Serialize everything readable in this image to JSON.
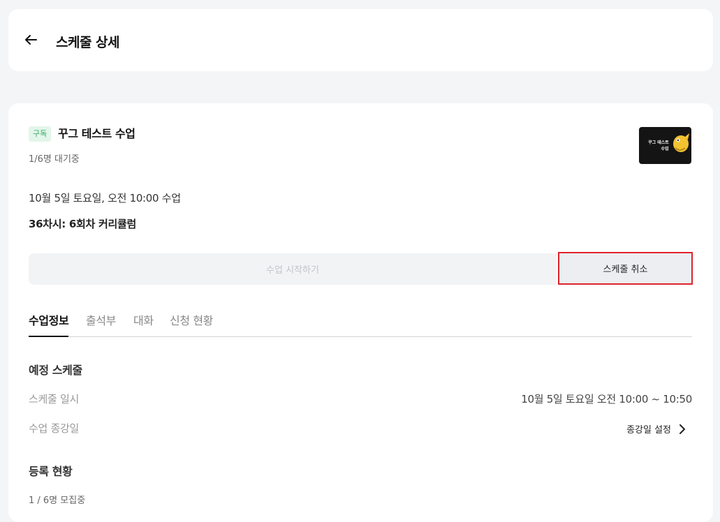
{
  "header": {
    "title": "스케줄 상세",
    "back_icon": "arrow-left-icon"
  },
  "class": {
    "badge": "구독",
    "title": "꾸그 테스트 수업",
    "waiting": "1/6명 대기중",
    "thumbnail_text_line1": "꾸그 테스트",
    "thumbnail_text_line2": "수업",
    "schedule": "10월 5일 토요일, 오전 10:00 수업",
    "curriculum": "36차시: 6회차 커리큘럼"
  },
  "actions": {
    "start_label": "수업 시작하기",
    "cancel_label": "스케줄 취소"
  },
  "tabs": [
    {
      "label": "수업정보",
      "active": true
    },
    {
      "label": "출석부",
      "active": false
    },
    {
      "label": "대화",
      "active": false
    },
    {
      "label": "신청 현황",
      "active": false
    }
  ],
  "planned": {
    "title": "예정 스케줄",
    "datetime_label": "스케줄 일시",
    "datetime_value": "10월 5일 토요일 오전 10:00 ~ 10:50",
    "end_label": "수업 종강일",
    "end_action": "종강일 설정"
  },
  "registration": {
    "title": "등록 현황",
    "status": "1 / 6명 모집중"
  },
  "colors": {
    "highlight_border": "#e0222b",
    "badge_bg": "#e3f6ea",
    "badge_text": "#3aa865"
  }
}
